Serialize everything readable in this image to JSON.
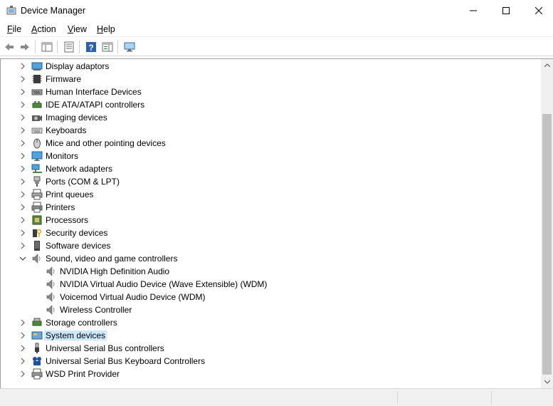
{
  "window": {
    "title": "Device Manager",
    "controls": {
      "minimize": "minimize",
      "maximize": "maximize",
      "close": "close"
    }
  },
  "menu": [
    {
      "label": "File",
      "accel": "F",
      "rest": "ile"
    },
    {
      "label": "Action",
      "accel": "A",
      "rest": "ction"
    },
    {
      "label": "View",
      "accel": "V",
      "rest": "iew"
    },
    {
      "label": "Help",
      "accel": "H",
      "rest": "elp"
    }
  ],
  "toolbar": {
    "buttons": [
      "back-arrow-icon",
      "forward-arrow-icon",
      "show-hide-console-tree-icon",
      "properties-icon",
      "help-icon",
      "action-pane-icon",
      "scan-hardware-icon"
    ]
  },
  "tree": {
    "nodes": [
      {
        "label": "Display adaptors",
        "icon": "display-adapter-icon",
        "expanded": false
      },
      {
        "label": "Firmware",
        "icon": "firmware-icon",
        "expanded": false
      },
      {
        "label": "Human Interface Devices",
        "icon": "hid-icon",
        "expanded": false
      },
      {
        "label": "IDE ATA/ATAPI controllers",
        "icon": "ide-controller-icon",
        "expanded": false
      },
      {
        "label": "Imaging devices",
        "icon": "camera-icon",
        "expanded": false
      },
      {
        "label": "Keyboards",
        "icon": "keyboard-icon",
        "expanded": false
      },
      {
        "label": "Mice and other pointing devices",
        "icon": "mouse-icon",
        "expanded": false
      },
      {
        "label": "Monitors",
        "icon": "monitor-icon",
        "expanded": false
      },
      {
        "label": "Network adapters",
        "icon": "network-adapter-icon",
        "expanded": false
      },
      {
        "label": "Ports (COM & LPT)",
        "icon": "port-icon",
        "expanded": false
      },
      {
        "label": "Print queues",
        "icon": "print-queue-icon",
        "expanded": false
      },
      {
        "label": "Printers",
        "icon": "printer-icon",
        "expanded": false
      },
      {
        "label": "Processors",
        "icon": "processor-icon",
        "expanded": false
      },
      {
        "label": "Security devices",
        "icon": "security-device-icon",
        "expanded": false
      },
      {
        "label": "Software devices",
        "icon": "software-device-icon",
        "expanded": false
      },
      {
        "label": "Sound, video and game controllers",
        "icon": "speaker-icon",
        "expanded": true
      },
      {
        "label": "NVIDIA High Definition Audio",
        "icon": "speaker-icon",
        "child": true
      },
      {
        "label": "NVIDIA Virtual Audio Device (Wave Extensible) (WDM)",
        "icon": "speaker-icon",
        "child": true
      },
      {
        "label": "Voicemod Virtual Audio Device (WDM)",
        "icon": "speaker-icon",
        "child": true
      },
      {
        "label": "Wireless Controller",
        "icon": "speaker-icon",
        "child": true
      },
      {
        "label": "Storage controllers",
        "icon": "storage-controller-icon",
        "expanded": false
      },
      {
        "label": "System devices",
        "icon": "system-device-icon",
        "expanded": false,
        "selected": true
      },
      {
        "label": "Universal Serial Bus controllers",
        "icon": "usb-icon",
        "expanded": false
      },
      {
        "label": "Universal Serial Bus Keyboard Controllers",
        "icon": "usb-keyboard-icon",
        "expanded": false
      },
      {
        "label": "WSD Print Provider",
        "icon": "wsd-printer-icon",
        "expanded": false
      }
    ]
  },
  "colors": {
    "selection": "#cce8ff",
    "accent_blue": "#1f6fb8"
  }
}
